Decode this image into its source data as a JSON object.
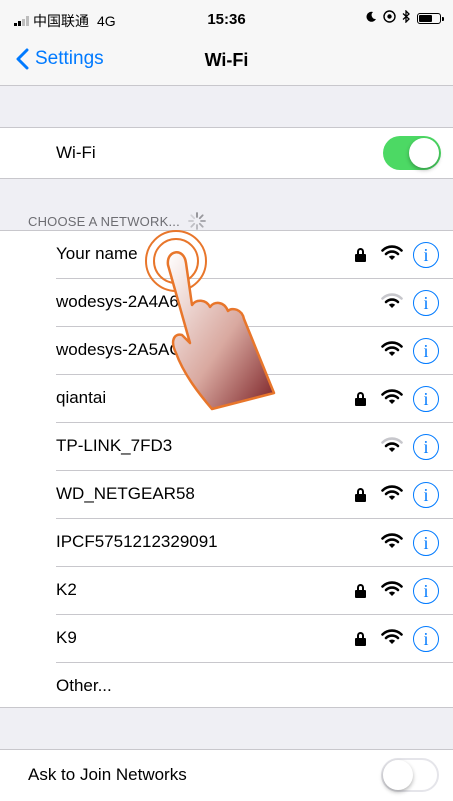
{
  "status_bar": {
    "carrier": "中国联通",
    "network": "4G",
    "time": "15:36",
    "icons": [
      "moon-icon",
      "location-icon",
      "bluetooth-icon"
    ],
    "signal_level": 0.5,
    "battery_level": 0.7
  },
  "nav": {
    "back_label": "Settings",
    "title": "Wi-Fi"
  },
  "wifi_row": {
    "label": "Wi-Fi",
    "enabled": true
  },
  "section_header": "CHOOSE A NETWORK...",
  "networks": [
    {
      "name": "Your name",
      "locked": true,
      "strength": 3
    },
    {
      "name": "wodesys-2A4A64",
      "locked": false,
      "strength": 2
    },
    {
      "name": "wodesys-2A5AC0",
      "locked": false,
      "strength": 3
    },
    {
      "name": "qiantai",
      "locked": true,
      "strength": 3
    },
    {
      "name": "TP-LINK_7FD3",
      "locked": false,
      "strength": 2
    },
    {
      "name": "WD_NETGEAR58",
      "locked": true,
      "strength": 3
    },
    {
      "name": "IPCF5751212329091",
      "locked": false,
      "strength": 3
    },
    {
      "name": "K2",
      "locked": true,
      "strength": 3
    },
    {
      "name": "K9",
      "locked": true,
      "strength": 3
    }
  ],
  "other_label": "Other...",
  "info_glyph": "i",
  "ask_row": {
    "label": "Ask to Join Networks",
    "enabled": false
  },
  "colors": {
    "accent": "#007aff",
    "toggle_on": "#4cd964",
    "background": "#efeff4",
    "pointer": "#e8762b"
  }
}
